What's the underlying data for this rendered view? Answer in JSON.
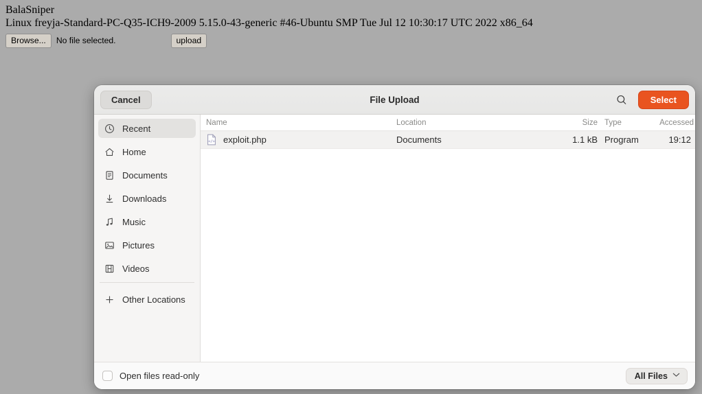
{
  "page": {
    "app_name": "BalaSniper",
    "uname": "Linux freyja-Standard-PC-Q35-ICH9-2009 5.15.0-43-generic #46-Ubuntu SMP Tue Jul 12 10:30:17 UTC 2022 x86_64",
    "browse_label": "Browse...",
    "no_file_text": "No file selected.",
    "upload_label": "upload"
  },
  "dialog": {
    "title": "File Upload",
    "cancel_label": "Cancel",
    "select_label": "Select",
    "search_icon": "search-icon",
    "accent_color": "#e95420",
    "sidebar": [
      {
        "label": "Recent",
        "icon": "clock-icon",
        "selected": true
      },
      {
        "label": "Home",
        "icon": "home-icon",
        "selected": false
      },
      {
        "label": "Documents",
        "icon": "document-icon",
        "selected": false
      },
      {
        "label": "Downloads",
        "icon": "download-icon",
        "selected": false
      },
      {
        "label": "Music",
        "icon": "music-note-icon",
        "selected": false
      },
      {
        "label": "Pictures",
        "icon": "image-icon",
        "selected": false
      },
      {
        "label": "Videos",
        "icon": "film-icon",
        "selected": false
      },
      {
        "label": "Other Locations",
        "icon": "plus-icon",
        "selected": false
      }
    ],
    "columns": {
      "name": "Name",
      "location": "Location",
      "size": "Size",
      "type": "Type",
      "accessed": "Accessed"
    },
    "files": [
      {
        "name": "exploit.php",
        "location": "Documents",
        "size": "1.1 kB",
        "type": "Program",
        "accessed": "19:12",
        "icon": "code-file-icon"
      }
    ],
    "footer": {
      "readonly_label": "Open files read-only",
      "readonly_checked": false,
      "filter_label": "All Files",
      "filter_chevron": "⌄"
    }
  }
}
